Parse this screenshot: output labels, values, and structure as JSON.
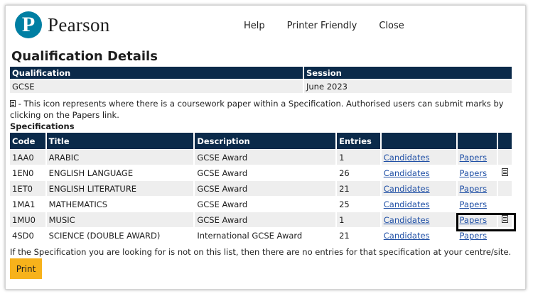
{
  "brand": {
    "logo_letter": "P",
    "name": "Pearson",
    "color": "#007fa3"
  },
  "nav": {
    "help": "Help",
    "printer_friendly": "Printer Friendly",
    "close": "Close"
  },
  "page_title": "Qualification Details",
  "qualification_table": {
    "headers": [
      "Qualification",
      "Session"
    ],
    "values": [
      "GCSE",
      "June 2023"
    ]
  },
  "coursework_note": "- This icon represents where there is a coursework paper within a Specification. Authorised users can submit marks by clicking on the Papers link.",
  "specifications_heading": "Specifications",
  "spec_table": {
    "headers": [
      "Code",
      "Title",
      "Description",
      "Entries"
    ],
    "rows": [
      {
        "code": "1AA0",
        "title": "ARABIC",
        "description": "GCSE Award",
        "entries": "1",
        "candidates": "Candidates",
        "papers": "Papers",
        "coursework": false
      },
      {
        "code": "1EN0",
        "title": "ENGLISH LANGUAGE",
        "description": "GCSE Award",
        "entries": "26",
        "candidates": "Candidates",
        "papers": "Papers",
        "coursework": true
      },
      {
        "code": "1ET0",
        "title": "ENGLISH LITERATURE",
        "description": "GCSE Award",
        "entries": "21",
        "candidates": "Candidates",
        "papers": "Papers",
        "coursework": false
      },
      {
        "code": "1MA1",
        "title": "MATHEMATICS",
        "description": "GCSE Award",
        "entries": "25",
        "candidates": "Candidates",
        "papers": "Papers",
        "coursework": false
      },
      {
        "code": "1MU0",
        "title": "MUSIC",
        "description": "GCSE Award",
        "entries": "1",
        "candidates": "Candidates",
        "papers": "Papers",
        "coursework": true
      },
      {
        "code": "4SD0",
        "title": "SCIENCE (DOUBLE AWARD)",
        "description": "International GCSE Award",
        "entries": "21",
        "candidates": "Candidates",
        "papers": "Papers",
        "coursework": false
      }
    ]
  },
  "footer_note": "If the Specification you are looking for is not on this list, then there are no entries for that specification at your centre/site.",
  "print_label": "Print",
  "colors": {
    "header_navy": "#0b2a4a",
    "link_blue": "#1f4fa5",
    "print_button": "#f7b21b"
  }
}
